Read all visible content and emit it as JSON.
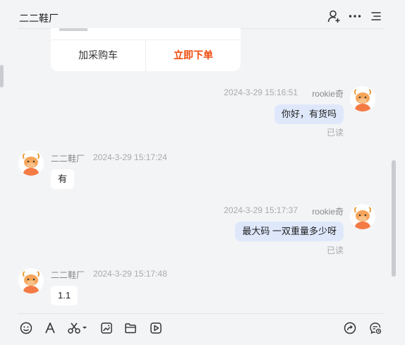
{
  "header": {
    "title": "二二鞋厂",
    "icons": [
      "add-person-icon",
      "more-icon",
      "menu-list-icon"
    ]
  },
  "product_card": {
    "add_to_cart": "加采购车",
    "buy_now": "立即下单",
    "buy_color": "#f04a0a"
  },
  "messages": [
    {
      "direction": "out",
      "sender": "rookie奇",
      "time": "2024-3-29 15:16:51",
      "text": "你好，有货吗",
      "status": "已读"
    },
    {
      "direction": "in",
      "sender": "二二鞋厂",
      "time": "2024-3-29 15:17:24",
      "text": "有"
    },
    {
      "direction": "out",
      "sender": "rookie奇",
      "time": "2024-3-29 15:17:37",
      "text": "最大码 一双重量多少呀",
      "status": "已读"
    },
    {
      "direction": "in",
      "sender": "二二鞋厂",
      "time": "2024-3-29 15:17:48",
      "text": "1.1"
    }
  ],
  "toolbar": {
    "left_icons": [
      "emoji-icon",
      "font-icon",
      "scissors-icon",
      "image-icon",
      "folder-icon",
      "video-icon"
    ],
    "right_icons": [
      "share-icon",
      "chat-history-icon"
    ]
  },
  "colors": {
    "outgoing_bubble": "#dfe8fb",
    "incoming_bubble": "#ffffff",
    "background": "#f3f4f6"
  }
}
